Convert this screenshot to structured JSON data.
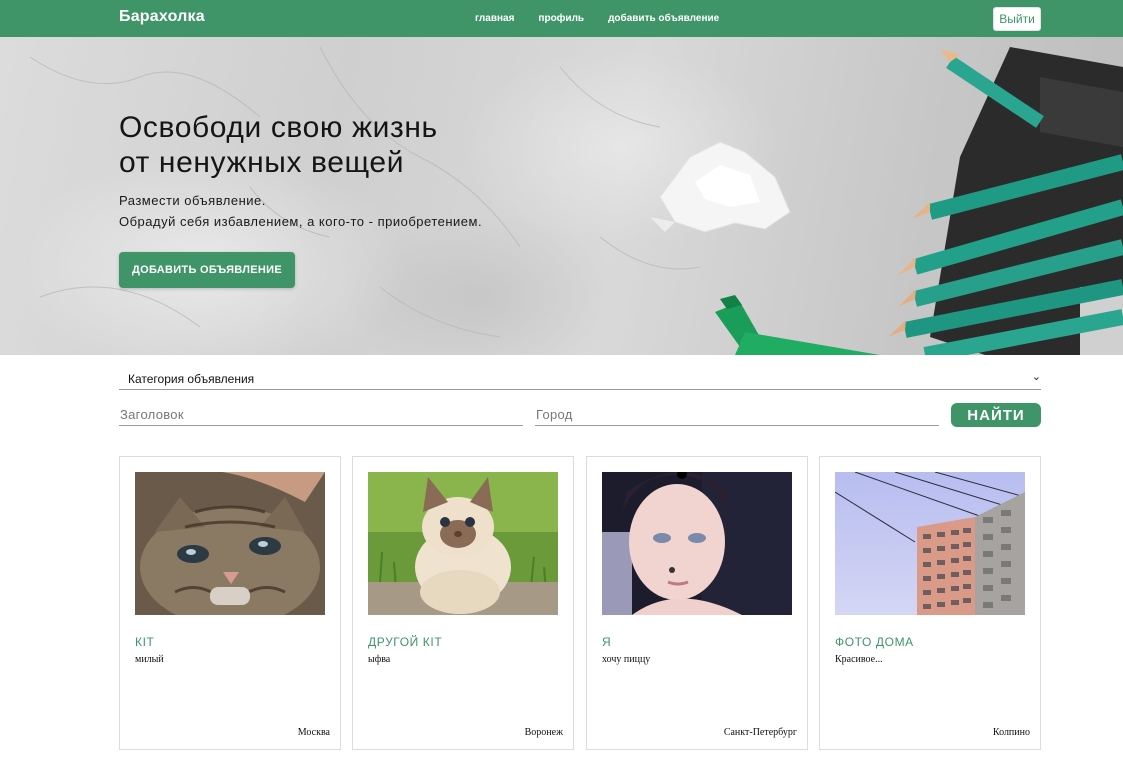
{
  "header": {
    "brand": "Барахолка",
    "nav": {
      "home": "главная",
      "profile": "профиль",
      "add_listing": "добавить объявление"
    },
    "logout_label": "Выйти"
  },
  "hero": {
    "title_line1": "Освободи свою жизнь",
    "title_line2": "от ненужных вещей",
    "text_line1": "Размести объявление.",
    "text_line2": "Обрадуй себя избавлением, а кого-то - приобретением.",
    "cta_label": "ДОБАВИТЬ ОБЪЯВЛЕНИЕ"
  },
  "search": {
    "category_label": "Категория объявления",
    "title_placeholder": "Заголовок",
    "city_placeholder": "Город",
    "submit_label": "НАЙТИ"
  },
  "listings": [
    {
      "title": "кіт",
      "description": "милый",
      "city": "Москва"
    },
    {
      "title": "другой кіт",
      "description": "ыфва",
      "city": "Воронеж"
    },
    {
      "title": "я",
      "description": "хочу пиццу",
      "city": "Санкт-Петербург"
    },
    {
      "title": "фото дома",
      "description": "Красивое...",
      "city": "Колпино"
    }
  ],
  "colors": {
    "accent": "#3f9568",
    "card_title": "#3f9568",
    "border": "#dcdcdc"
  }
}
